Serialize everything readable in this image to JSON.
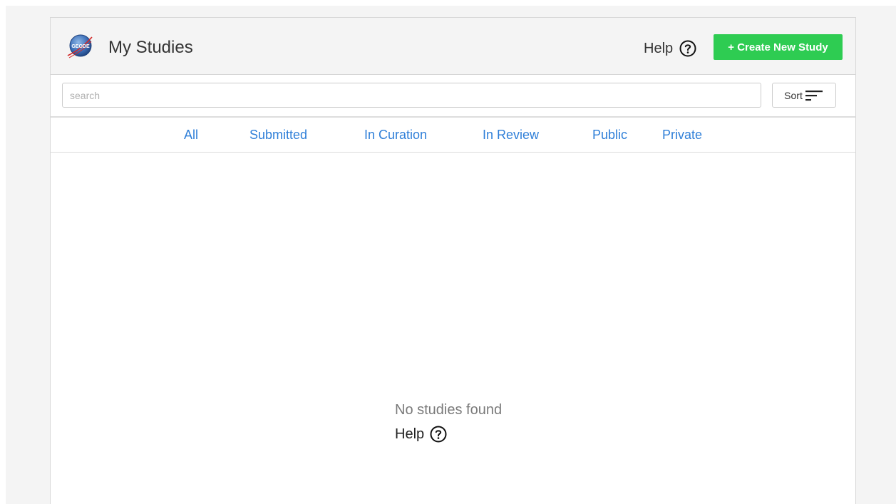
{
  "header": {
    "title": "My Studies",
    "logo_text": "GEODE",
    "logo_icon": "geode-logo-icon",
    "help_label": "Help",
    "help_icon": "question-circle-icon",
    "create_button_label": "+ Create New Study"
  },
  "search": {
    "placeholder": "search",
    "value": "",
    "sort_label": "Sort",
    "sort_icon": "sort-lines-icon"
  },
  "tabs": [
    {
      "label": "All"
    },
    {
      "label": "Submitted"
    },
    {
      "label": "In Curation"
    },
    {
      "label": "In Review"
    },
    {
      "label": "Public"
    },
    {
      "label": "Private"
    }
  ],
  "empty_state": {
    "message": "No studies found",
    "help_label": "Help",
    "help_icon": "question-circle-icon"
  },
  "colors": {
    "accent_green": "#2ecc52",
    "link_blue": "#2f7fd8",
    "header_bg": "#f4f4f4"
  }
}
